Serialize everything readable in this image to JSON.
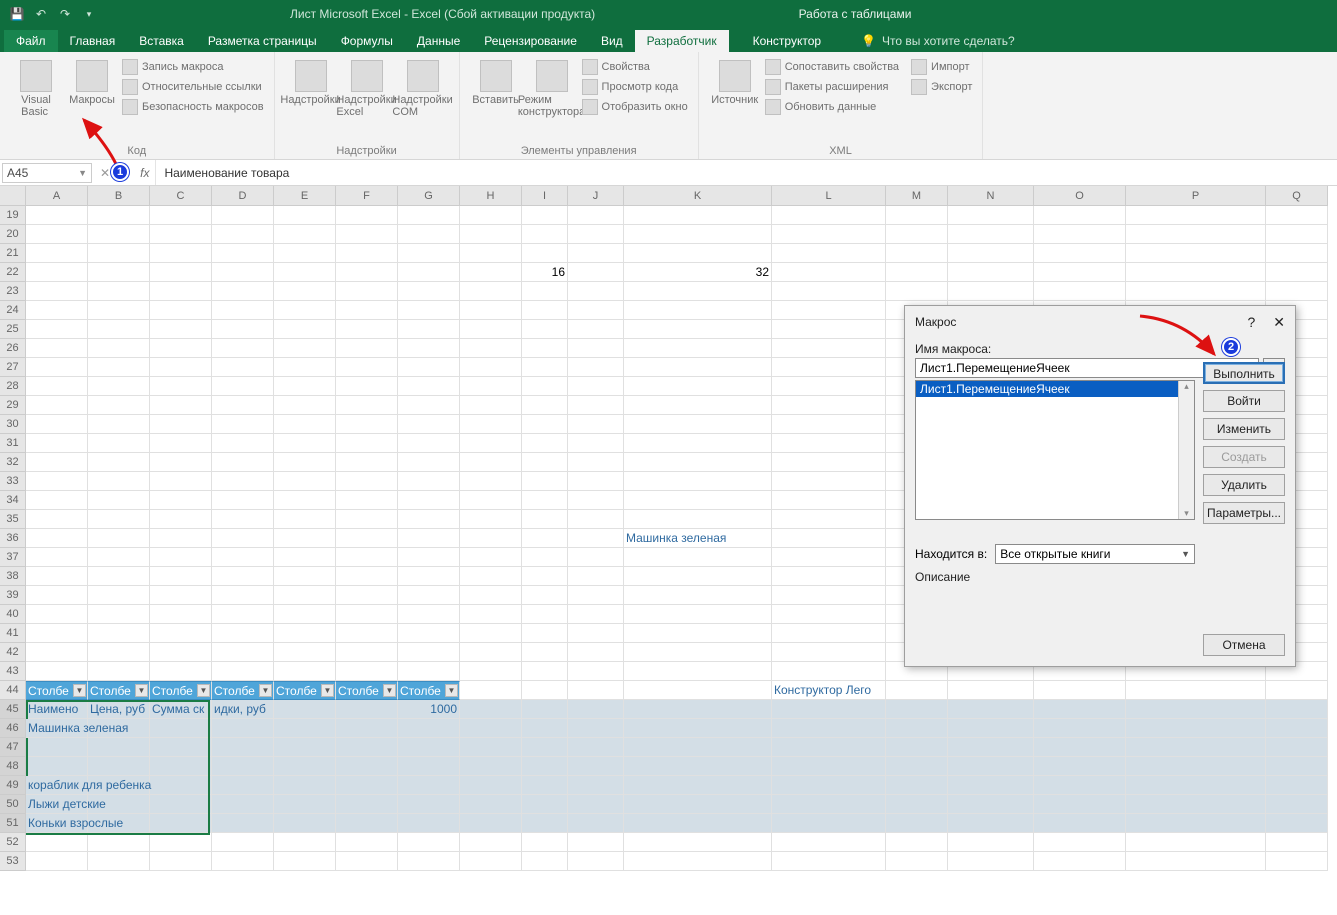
{
  "title": "Лист Microsoft Excel - Excel (Сбой активации продукта)",
  "context_tab_header": "Работа с таблицами",
  "tabs": {
    "file": "Файл",
    "items": [
      "Главная",
      "Вставка",
      "Разметка страницы",
      "Формулы",
      "Данные",
      "Рецензирование",
      "Вид",
      "Разработчик",
      "Конструктор"
    ],
    "active": "Разработчик",
    "tellme": "Что вы хотите сделать?"
  },
  "ribbon": {
    "groups": [
      {
        "label": "Код",
        "big": [
          {
            "t": "Visual Basic"
          },
          {
            "t": "Макросы"
          }
        ],
        "small": [
          "Запись макроса",
          "Относительные ссылки",
          "Безопасность макросов"
        ]
      },
      {
        "label": "Надстройки",
        "big": [
          {
            "t": "Надстройки"
          },
          {
            "t": "Надстройки Excel"
          },
          {
            "t": "Надстройки COM"
          }
        ],
        "small": []
      },
      {
        "label": "Элементы управления",
        "big": [
          {
            "t": "Вставить"
          },
          {
            "t": "Режим конструктора"
          }
        ],
        "small": [
          "Свойства",
          "Просмотр кода",
          "Отобразить окно"
        ]
      },
      {
        "label": "XML",
        "big": [
          {
            "t": "Источник"
          }
        ],
        "small": [
          "Сопоставить свойства",
          "Пакеты расширения",
          "Обновить данные"
        ],
        "small2": [
          "Импорт",
          "Экспорт"
        ]
      }
    ]
  },
  "formula_bar": {
    "namebox": "A45",
    "formula": "Наименование товара"
  },
  "columns": [
    "A",
    "B",
    "C",
    "D",
    "E",
    "F",
    "G",
    "H",
    "I",
    "J",
    "K",
    "L",
    "M",
    "N",
    "O",
    "P",
    "Q"
  ],
  "first_row": 19,
  "last_row": 53,
  "cells": {
    "22": {
      "I": "16",
      "K": "32"
    },
    "36": {
      "K": "Машинка зеленая"
    },
    "44": {
      "A": "Столбе",
      "B": "Столбе",
      "C": "Столбе",
      "D": "Столбе",
      "E": "Столбе",
      "F": "Столбе",
      "G": "Столбе",
      "L": "Конструктор Лего"
    },
    "45": {
      "A": "Наимено",
      "B": "Цена, руб",
      "C": "Сумма ск",
      "D": "идки, руб",
      "G": "1000"
    },
    "46": {
      "A": "Машинка зеленая"
    },
    "49": {
      "A": "кораблик для ребенка"
    },
    "50": {
      "A": "Лыжи детские"
    },
    "51": {
      "A": "Коньки взрослые"
    }
  },
  "dialog": {
    "title": "Макрос",
    "name_label": "Имя макроса:",
    "name_value": "Лист1.ПеремещениеЯчеек",
    "list": [
      "Лист1.ПеремещениеЯчеек"
    ],
    "location_label": "Находится в:",
    "location_value": "Все открытые книги",
    "desc_label": "Описание",
    "buttons": {
      "run": "Выполнить",
      "step": "Войти",
      "edit": "Изменить",
      "create": "Создать",
      "delete": "Удалить",
      "options": "Параметры...",
      "cancel": "Отмена"
    }
  },
  "callouts": {
    "1": "1",
    "2": "2"
  }
}
